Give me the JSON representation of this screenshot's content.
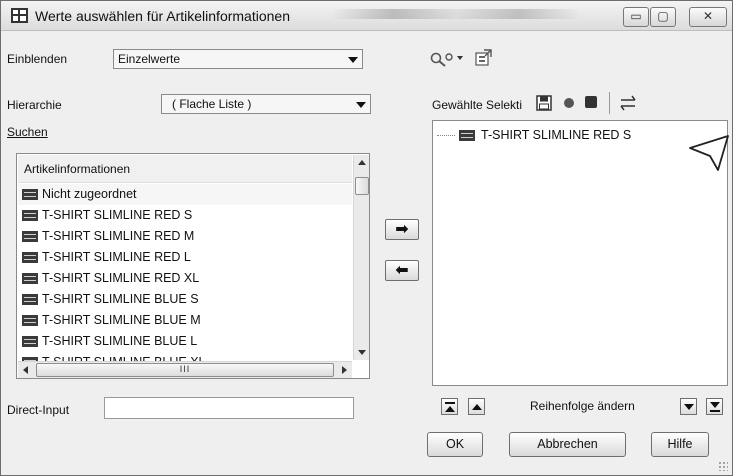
{
  "window": {
    "title": "Werte auswählen für Artikelinformationen",
    "minimize_label": "▭",
    "maximize_label": "▢",
    "close_label": "✕"
  },
  "top": {
    "einblenden_label": "Einblenden",
    "einblenden_value": "Einzelwerte",
    "toolbar_tool_icon": "wrench-gear-icon",
    "toolbar_export_icon": "export-icon"
  },
  "left": {
    "hierarchie_label": "Hierarchie",
    "hierarchie_value": "( Flache Liste )",
    "suchen_link": "Suchen",
    "list_header": "Artikelinformationen",
    "items": [
      "Nicht zugeordnet",
      "T-SHIRT SLIMLINE RED S",
      "T-SHIRT SLIMLINE RED M",
      "T-SHIRT SLIMLINE RED L",
      "T-SHIRT SLIMLINE RED XL",
      "T-SHIRT SLIMLINE BLUE S",
      "T-SHIRT SLIMLINE BLUE M",
      "T-SHIRT SLIMLINE BLUE L",
      "T-SHIRT SLIMLINE BLUE XL"
    ],
    "hscroll_grip": "III",
    "direct_input_label": "Direct-Input",
    "direct_input_value": ""
  },
  "middle": {
    "add_arrow": "➡",
    "remove_arrow": "⬅"
  },
  "right": {
    "selection_label": "Gewählte Selekti",
    "selected_items": [
      "T-SHIRT SLIMLINE RED S"
    ],
    "reorder_label": "Reihenfolge ändern"
  },
  "buttons": {
    "ok": "OK",
    "cancel": "Abbrechen",
    "help": "Hilfe"
  }
}
